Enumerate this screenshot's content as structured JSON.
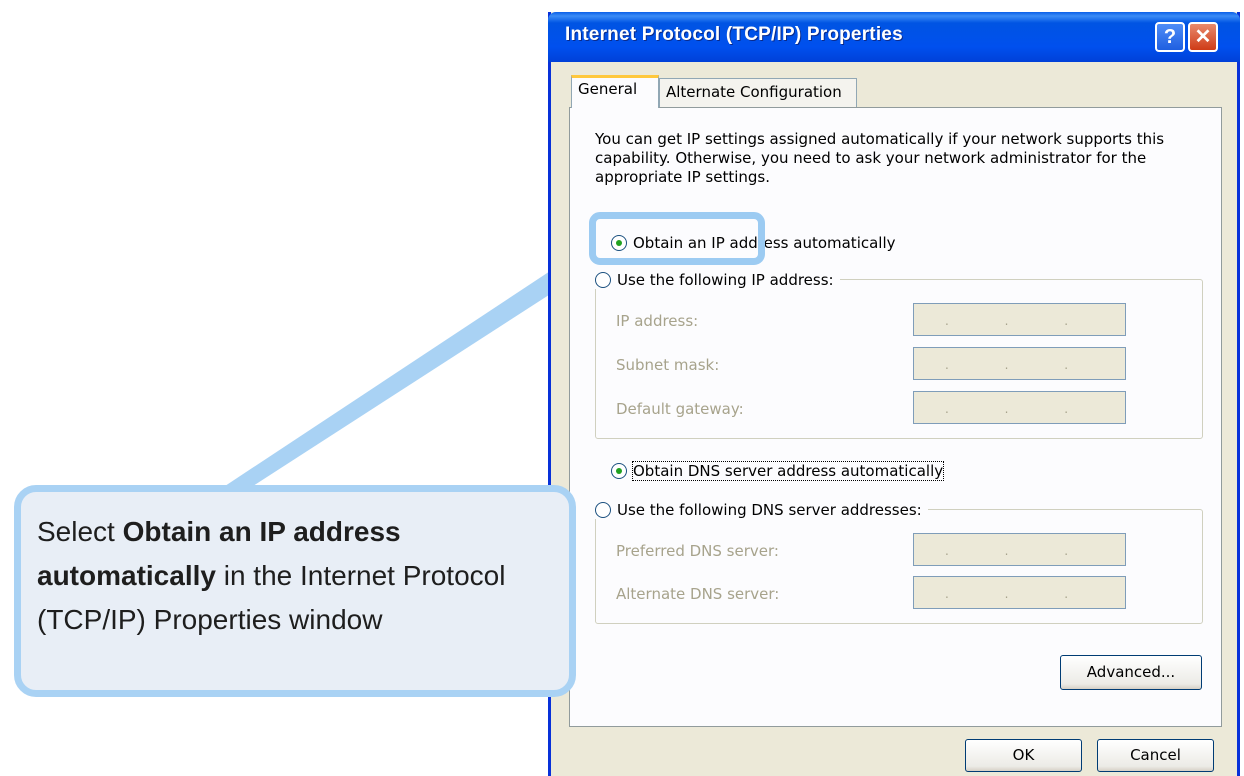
{
  "dialog": {
    "title": "Internet Protocol (TCP/IP) Properties",
    "help_glyph": "?",
    "close_glyph": "✕",
    "tabs": [
      "General",
      "Alternate Configuration"
    ],
    "active_tab": "General",
    "description": "You can get IP settings assigned automatically if your network supports this capability. Otherwise, you need to ask your network administrator for the appropriate IP settings.",
    "ip_options": {
      "auto_label": "Obtain an IP address automatically",
      "manual_label": "Use the following IP address:",
      "selected": "auto",
      "fields": [
        {
          "label": "IP address:",
          "value": ". . ."
        },
        {
          "label": "Subnet mask:",
          "value": ". . ."
        },
        {
          "label": "Default gateway:",
          "value": ". . ."
        }
      ]
    },
    "dns_options": {
      "auto_label": "Obtain DNS server address automatically",
      "manual_label": "Use the following DNS server addresses:",
      "selected": "auto",
      "fields": [
        {
          "label": "Preferred DNS server:",
          "value": ". . ."
        },
        {
          "label": "Alternate DNS server:",
          "value": ". . ."
        }
      ]
    },
    "buttons": {
      "advanced": "Advanced...",
      "ok": "OK",
      "cancel": "Cancel"
    }
  },
  "callout": {
    "text_pre": "Select ",
    "text_bold": "Obtain an IP address automatically",
    "text_post": " in the Internet Protocol (TCP/IP) Properties window"
  },
  "colors": {
    "titlebar": "#0054e3",
    "callout_border": "#a9d2f4",
    "callout_fill": "#e8eef6",
    "dialog_bg": "#ece9d8"
  }
}
